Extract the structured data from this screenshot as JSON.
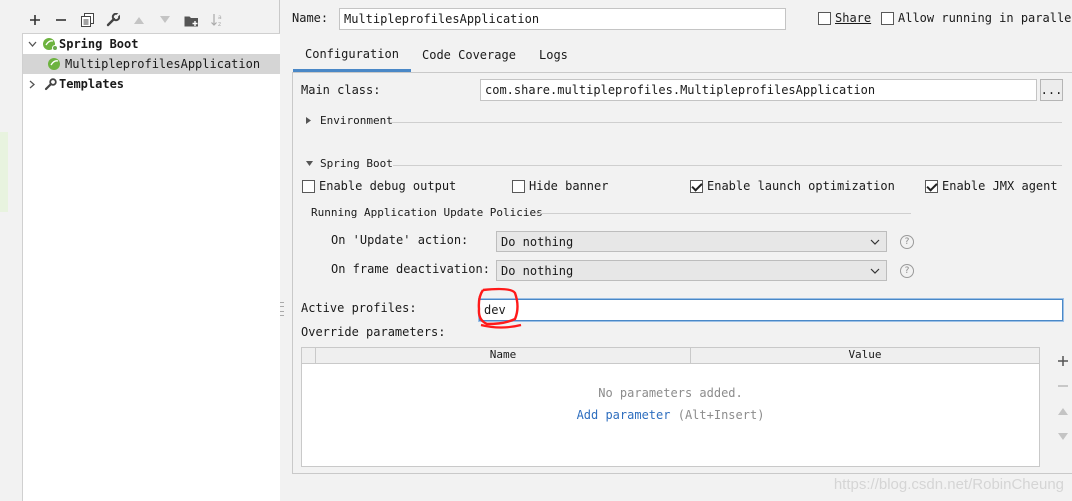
{
  "toolbar": {
    "icons": [
      "add-icon",
      "remove-icon",
      "copy-icon",
      "wrench-icon",
      "move-up-icon",
      "move-down-icon",
      "folder-add-icon",
      "sort-icon"
    ]
  },
  "tree": {
    "spring_boot_label": "Spring Boot",
    "app_label": "MultipleprofilesApplication",
    "templates_label": "Templates"
  },
  "header": {
    "name_label": "Name:",
    "name_value": "MultipleprofilesApplication",
    "share_label": "Share",
    "allow_parallel_label": "Allow running in parallel"
  },
  "tabs": [
    "Configuration",
    "Code Coverage",
    "Logs"
  ],
  "config": {
    "main_class_label": "Main class:",
    "main_class_value": "com.share.multipleprofiles.MultipleprofilesApplication",
    "browse_label": "...",
    "environment_label": "Environment",
    "spring_boot_section_label": "Spring Boot",
    "enable_debug_label": "Enable debug output",
    "hide_banner_label": "Hide banner",
    "launch_opt_label": "Enable launch optimization",
    "jmx_label": "Enable JMX agent",
    "policies_label": "Running Application Update Policies",
    "update_action_label": "On 'Update' action:",
    "update_action_value": "Do nothing",
    "frame_deactivation_label": "On frame deactivation:",
    "frame_deactivation_value": "Do nothing",
    "active_profiles_label": "Active profiles:",
    "active_profiles_value": "dev",
    "override_label": "Override parameters:"
  },
  "params_table": {
    "columns": [
      "Name",
      "Value"
    ],
    "empty_text": "No parameters added.",
    "add_link": "Add parameter",
    "add_shortcut": "(Alt+Insert)"
  },
  "watermark": "https://blog.csdn.net/RobinCheung",
  "colors": {
    "accent": "#4a88c7",
    "link": "#2f6fbf",
    "annotation_red": "#ff1a1a",
    "spring_green": "#6db33f"
  }
}
